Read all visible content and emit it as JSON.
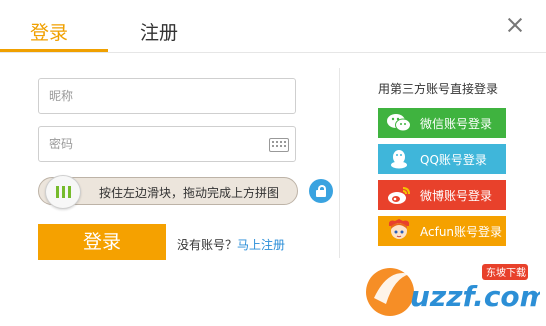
{
  "tabs": {
    "login": "登录",
    "register": "注册"
  },
  "form": {
    "nickname_placeholder": "昵称",
    "password_placeholder": "密码",
    "slider_text": "按住左边滑块，拖动完成上方拼图",
    "login_button": "登录",
    "no_account_text": "没有账号？",
    "register_link": "马上注册"
  },
  "third_party": {
    "title": "用第三方账号直接登录",
    "buttons": [
      {
        "label": "微信账号登录",
        "color": "#3fb33f"
      },
      {
        "label": "QQ账号登录",
        "color": "#3fb6da"
      },
      {
        "label": "微博账号登录",
        "color": "#e8412b"
      },
      {
        "label": "Acfun账号登录",
        "color": "#f5a100"
      }
    ]
  },
  "watermark": {
    "text": "uzzf.com",
    "tag": "东坡下载"
  },
  "colors": {
    "accent": "#f5a100",
    "link": "#2a8ed8",
    "slider_grip": "#76bb2c",
    "lock": "#3aa3e0"
  }
}
